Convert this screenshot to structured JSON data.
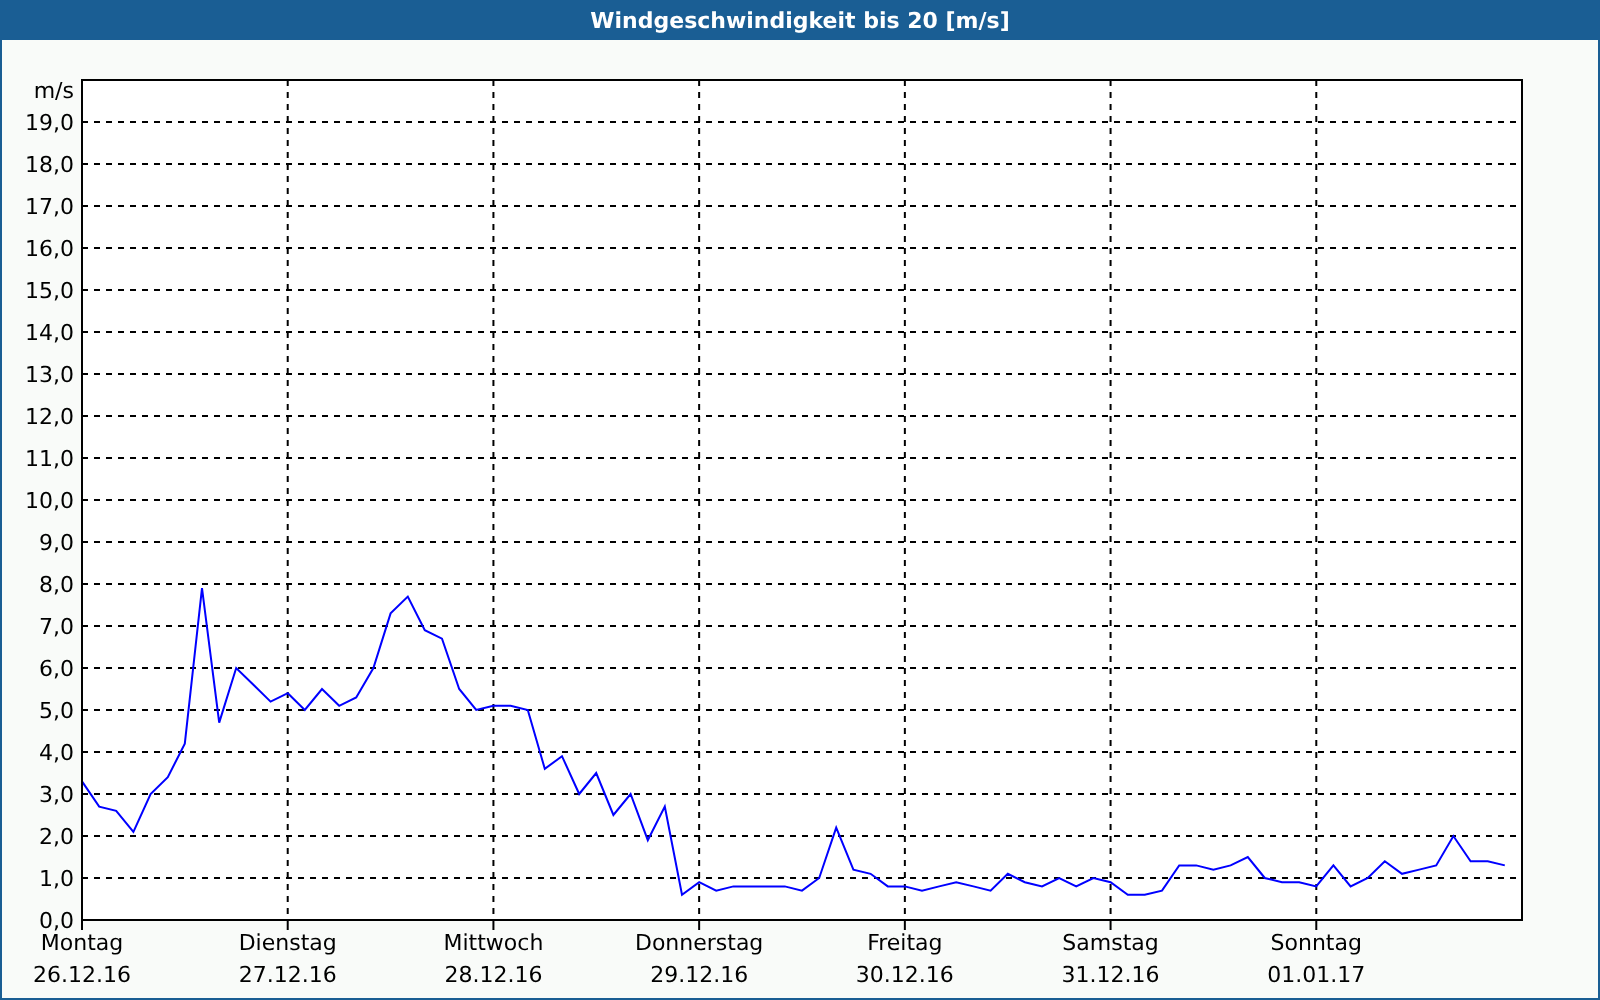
{
  "window": {
    "title": "Windgeschwindigkeit bis 20 [m/s]"
  },
  "chart_data": {
    "type": "line",
    "ylabel": "m/s",
    "grid": true,
    "ylim": [
      0,
      20
    ],
    "yticks": [
      {
        "value": 0,
        "label": "0,0"
      },
      {
        "value": 1,
        "label": "1,0"
      },
      {
        "value": 2,
        "label": "2,0"
      },
      {
        "value": 3,
        "label": "3,0"
      },
      {
        "value": 4,
        "label": "4,0"
      },
      {
        "value": 5,
        "label": "5,0"
      },
      {
        "value": 6,
        "label": "6,0"
      },
      {
        "value": 7,
        "label": "7,0"
      },
      {
        "value": 8,
        "label": "8,0"
      },
      {
        "value": 9,
        "label": "9,0"
      },
      {
        "value": 10,
        "label": "10,0"
      },
      {
        "value": 11,
        "label": "11,0"
      },
      {
        "value": 12,
        "label": "12,0"
      },
      {
        "value": 13,
        "label": "13,0"
      },
      {
        "value": 14,
        "label": "14,0"
      },
      {
        "value": 15,
        "label": "15,0"
      },
      {
        "value": 16,
        "label": "16,0"
      },
      {
        "value": 17,
        "label": "17,0"
      },
      {
        "value": 18,
        "label": "18,0"
      },
      {
        "value": 19,
        "label": "19,0"
      }
    ],
    "categories": [
      "Montag 26.12.16",
      null,
      null,
      null,
      null,
      null,
      null,
      null,
      null,
      null,
      null,
      null,
      "Dienstag 27.12.16",
      null,
      null,
      null,
      null,
      null,
      null,
      null,
      null,
      null,
      null,
      null,
      "Mittwoch 28.12.16",
      null,
      null,
      null,
      null,
      null,
      null,
      null,
      null,
      null,
      null,
      null,
      "Donnerstag 29.12.16",
      null,
      null,
      null,
      null,
      null,
      null,
      null,
      null,
      null,
      null,
      null,
      "Freitag 30.12.16",
      null,
      null,
      null,
      null,
      null,
      null,
      null,
      null,
      null,
      null,
      null,
      "Samstag 31.12.16",
      null,
      null,
      null,
      null,
      null,
      null,
      null,
      null,
      null,
      null,
      null,
      "Sonntag 01.01.17",
      null,
      null,
      null,
      null,
      null,
      null,
      null,
      null,
      null,
      null,
      null
    ],
    "series": [
      {
        "color": "#0000ff",
        "values": [
          3.3,
          2.7,
          2.6,
          2.1,
          3.0,
          3.4,
          4.2,
          7.9,
          4.7,
          6.0,
          5.6,
          5.2,
          5.4,
          5.0,
          5.5,
          5.1,
          5.3,
          6.0,
          7.3,
          7.7,
          6.9,
          6.7,
          5.5,
          5.0,
          5.1,
          5.1,
          5.0,
          3.6,
          3.9,
          3.0,
          3.5,
          2.5,
          3.0,
          1.9,
          2.7,
          0.6,
          0.9,
          0.7,
          0.8,
          0.8,
          0.8,
          0.8,
          0.7,
          1.0,
          2.2,
          1.2,
          1.1,
          0.8,
          0.8,
          0.7,
          0.8,
          0.9,
          0.8,
          0.7,
          1.1,
          0.9,
          0.8,
          1.0,
          0.8,
          1.0,
          0.9,
          0.6,
          0.6,
          0.7,
          1.3,
          1.3,
          1.2,
          1.3,
          1.5,
          1.0,
          0.9,
          0.9,
          0.8,
          1.3,
          0.8,
          1.0,
          1.4,
          1.1,
          1.2,
          1.3,
          2.0,
          1.4,
          1.4,
          1.3
        ]
      }
    ]
  }
}
